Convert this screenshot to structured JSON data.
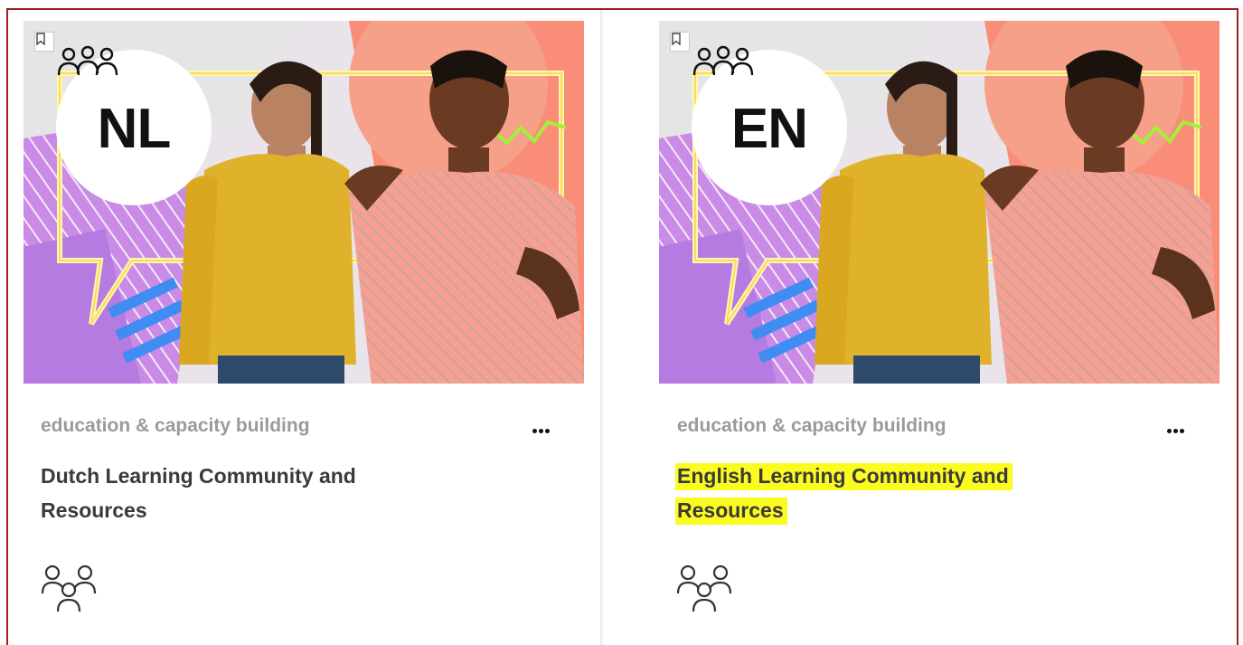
{
  "cards": [
    {
      "language_code": "NL",
      "category": "education & capacity building",
      "title": "Dutch Learning Community and Resources",
      "title_highlighted": false
    },
    {
      "language_code": "EN",
      "category": "education & capacity building",
      "title": "English Learning Community and Resources",
      "title_highlighted": true
    }
  ],
  "icons": {
    "bookmark": "bookmark-icon",
    "more": "more-options-icon",
    "community": "community-people-icon"
  },
  "colors": {
    "frame_border": "#a31f1f",
    "category_text": "#9a9a9a",
    "title_text": "#3a3a3a",
    "highlight": "#fbfb20"
  }
}
